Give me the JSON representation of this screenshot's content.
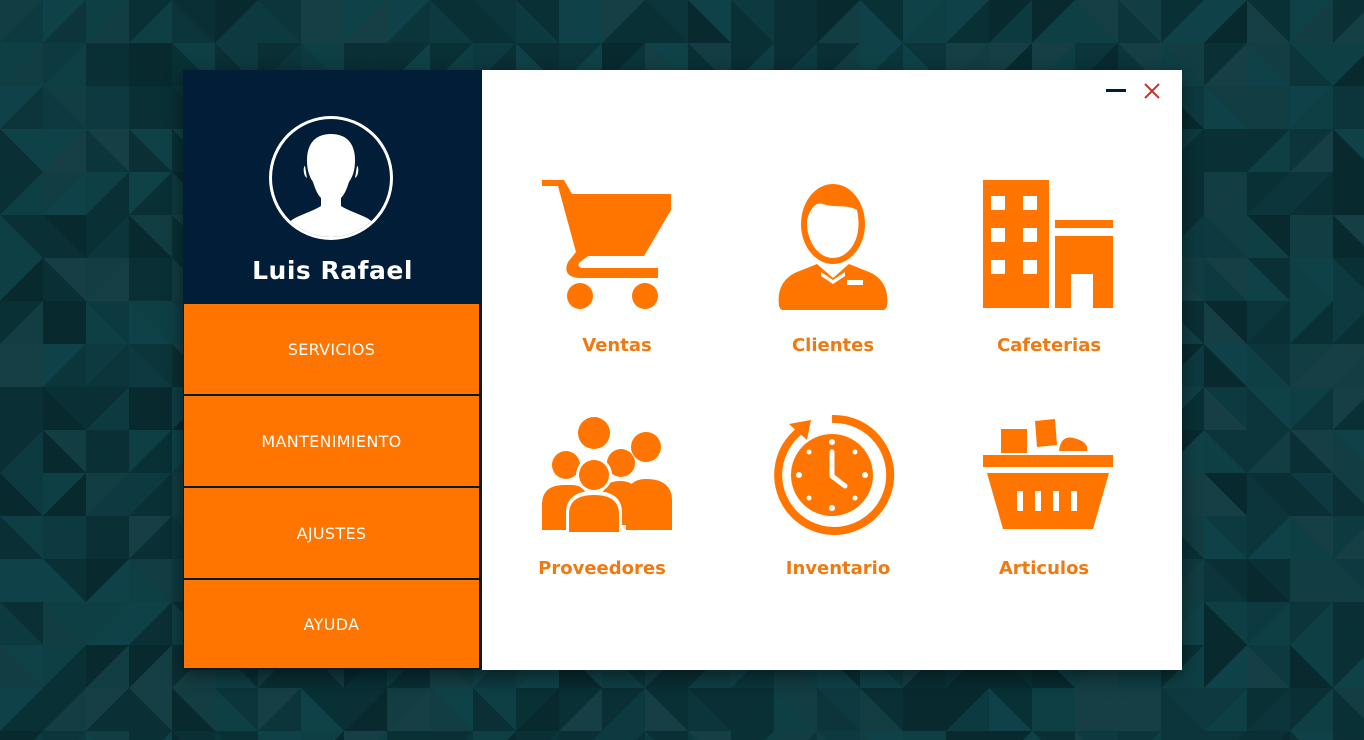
{
  "user": {
    "name": "Luis Rafael"
  },
  "menu": [
    {
      "label": "SERVICIOS"
    },
    {
      "label": "MANTENIMIENTO"
    },
    {
      "label": "AJUSTES"
    },
    {
      "label": "AYUDA"
    }
  ],
  "window_controls": {
    "minimize_icon": "minimize-icon",
    "close_icon": "close-icon"
  },
  "modules": [
    {
      "label": "Ventas",
      "icon": "shopping-cart-icon"
    },
    {
      "label": "Clientes",
      "icon": "customer-icon"
    },
    {
      "label": "Cafeterias",
      "icon": "building-icon"
    },
    {
      "label": "Proveedores",
      "icon": "group-icon"
    },
    {
      "label": "Inventario",
      "icon": "clock-refresh-icon"
    },
    {
      "label": "Articulos",
      "icon": "basket-icon"
    }
  ],
  "colors": {
    "accent": "#ff7500",
    "label": "#f07a12",
    "sidebar": "#011d37",
    "close": "#c0392b"
  }
}
